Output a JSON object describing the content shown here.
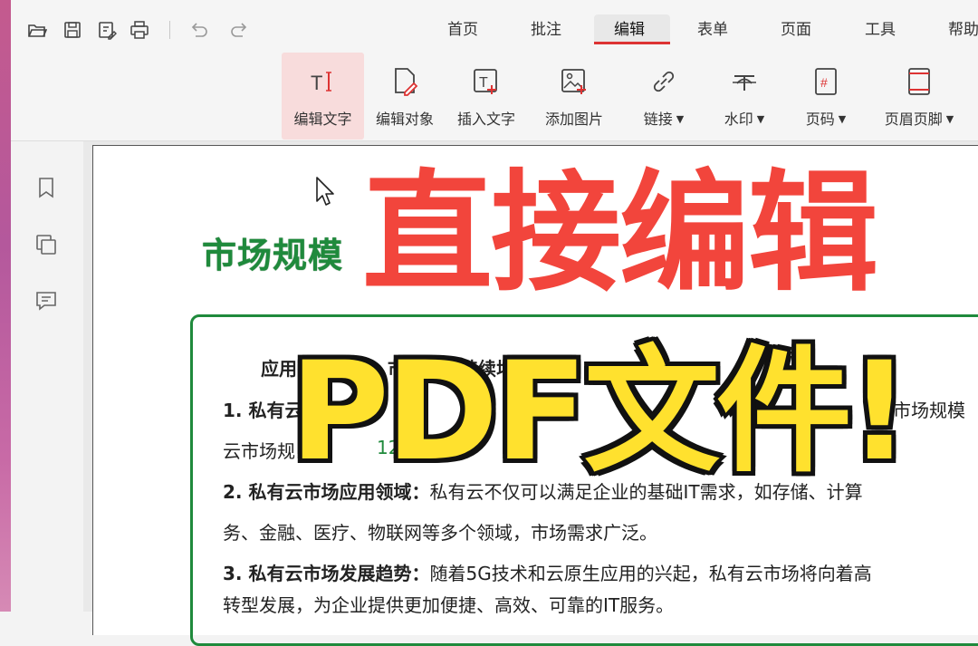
{
  "tabs": [
    "首页",
    "批注",
    "编辑",
    "表单",
    "页面",
    "工具",
    "帮助"
  ],
  "active_tab": "编辑",
  "tools": {
    "edit_text": "编辑文字",
    "edit_object": "编辑对象",
    "insert_text": "插入文字",
    "add_image": "添加图片",
    "link": "链接",
    "watermark": "水印",
    "page_number": "页码",
    "header_footer": "页眉页脚"
  },
  "document": {
    "heading": "市场规模",
    "line0": "应用范围广泛，市场需求持续增长",
    "line1_bold": "1. 私有云",
    "line1_tail": "市场规模",
    "line2_start": "云市场规",
    "line2_green": "12",
    "line3_bold": "2. 私有云市场应用领域：",
    "line3_text": "私有云不仅可以满足企业的基础IT需求，如存储、计算",
    "line4": "务、金融、医疗、物联网等多个领域，市场需求广泛。",
    "line5_bold": "3. 私有云市场发展趋势：",
    "line5_text": "随着5G技术和云原生应用的兴起，私有云市场将向着高",
    "line6": "转型发展，为企业提供更加便捷、高效、可靠的IT服务。"
  },
  "overlay": {
    "line1": "直接编辑",
    "line2": "PDF文件!"
  },
  "colors": {
    "accent_red": "#d33333",
    "overlay_red": "#f2453c",
    "overlay_yellow": "#ffe12e",
    "doc_green": "#1f8a3c"
  },
  "icons": [
    "open-icon",
    "save-icon",
    "save-as-icon",
    "print-icon",
    "undo-icon",
    "redo-icon",
    "bookmark-icon",
    "pages-icon",
    "comment-icon"
  ]
}
